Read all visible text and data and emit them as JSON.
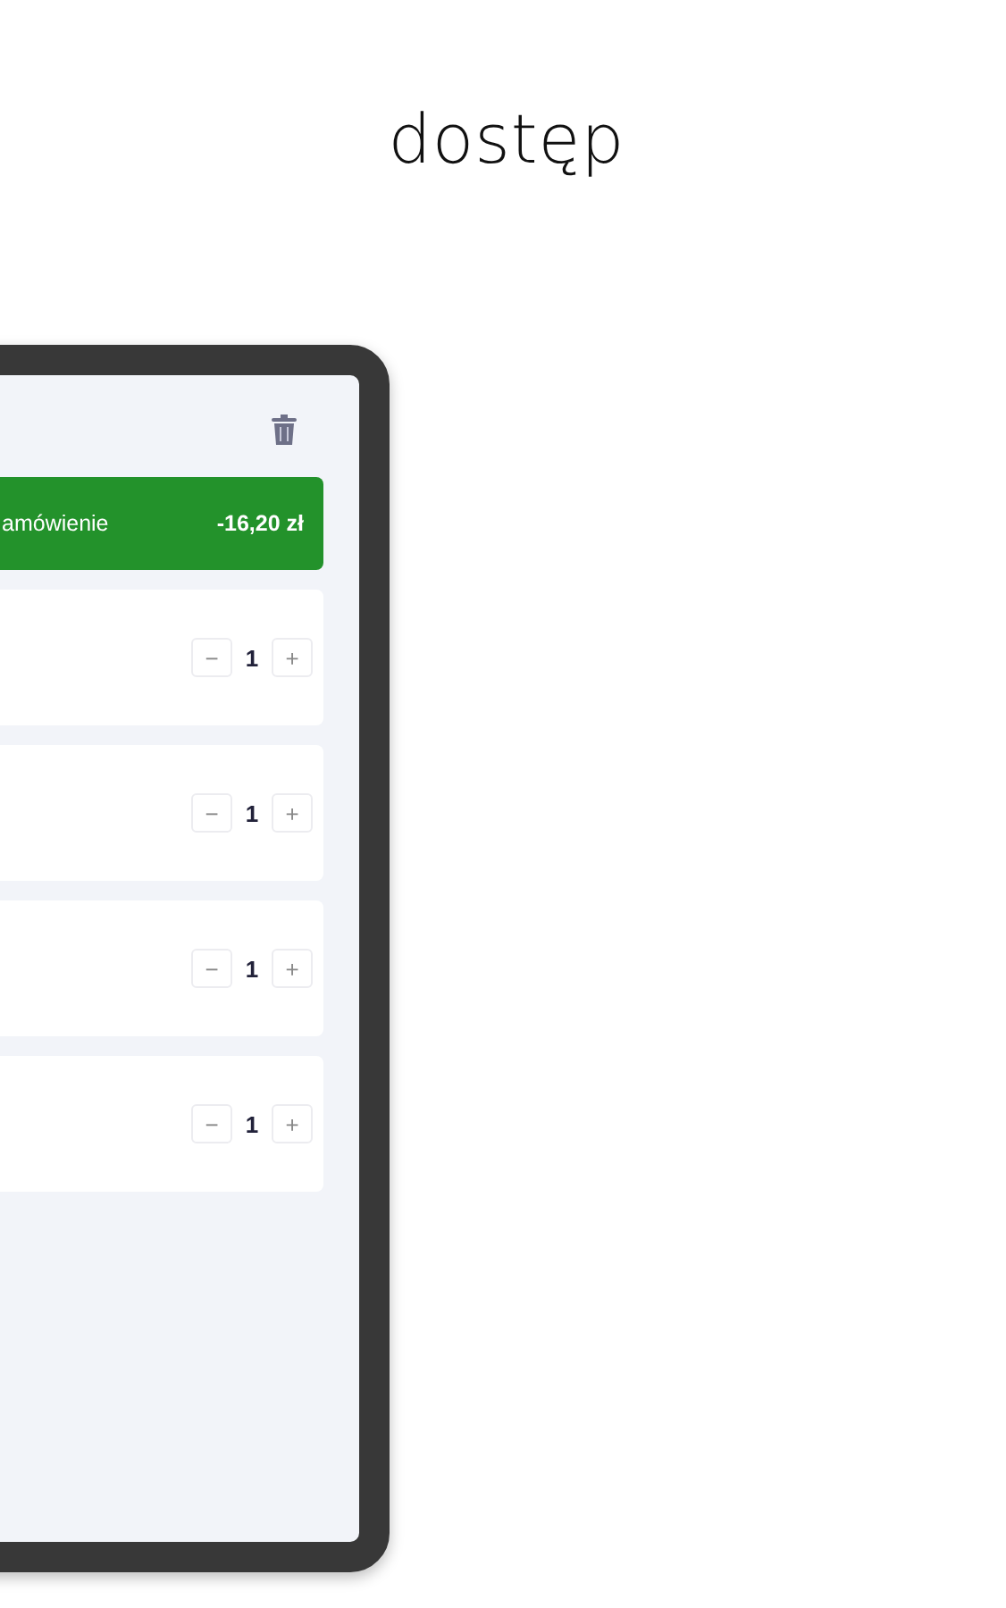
{
  "headline": "dostęp",
  "order_bar": {
    "label": "amówienie",
    "amount": "-16,20 zł"
  },
  "items": [
    {
      "quantity": "1",
      "minus": "−",
      "plus": "+"
    },
    {
      "quantity": "1",
      "minus": "−",
      "plus": "+"
    },
    {
      "quantity": "1",
      "minus": "−",
      "plus": "+"
    },
    {
      "quantity": "1",
      "minus": "−",
      "plus": "+"
    }
  ]
}
